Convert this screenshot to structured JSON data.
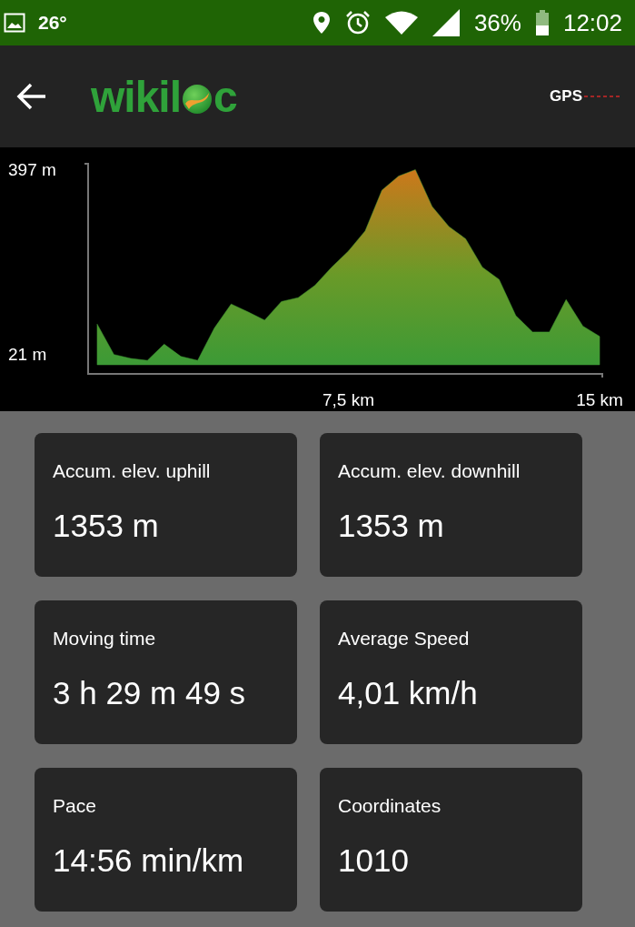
{
  "status_bar": {
    "temperature": "26°",
    "battery": "36%",
    "time": "12:02"
  },
  "header": {
    "logo": [
      "wikil",
      "c"
    ],
    "gps": "GPS"
  },
  "elevation": {
    "chart_data": {
      "type": "area",
      "x": [
        0,
        0.5,
        1,
        1.5,
        2,
        2.5,
        3,
        3.5,
        4,
        4.5,
        5,
        5.5,
        6,
        6.5,
        7,
        7.5,
        8,
        8.5,
        9,
        9.5,
        10,
        10.5,
        11,
        11.5,
        12,
        12.5,
        13,
        13.5,
        14,
        14.5,
        15
      ],
      "series": [
        {
          "color": "#3f9a35",
          "values": [
            83,
            21,
            13,
            9,
            42,
            17,
            9,
            75,
            124,
            108,
            91,
            129,
            137,
            162,
            199,
            232,
            273,
            356,
            385,
            398,
            323,
            282,
            257,
            199,
            174,
            100,
            67,
            67,
            133,
            79,
            58
          ]
        }
      ],
      "xlim": [
        -0.27,
        15.08
      ],
      "ylim": [
        0,
        410
      ],
      "xticks": [
        {
          "value": 7.5,
          "label": "7,5 km"
        },
        {
          "value": 15,
          "label": "15 km"
        }
      ],
      "yticks": [
        {
          "value": 21,
          "label": "21 m"
        },
        {
          "value": 397,
          "label": "397 m"
        }
      ]
    }
  },
  "stats": [
    {
      "label": "Accum. elev. uphill",
      "value": "1353 m"
    },
    {
      "label": "Accum. elev. downhill",
      "value": "1353 m"
    },
    {
      "label": "Moving time",
      "value": "3 h 29 m 49 s"
    },
    {
      "label": "Average Speed",
      "value": "4,01 km/h"
    },
    {
      "label": "Pace",
      "value": "14:56 min/km"
    },
    {
      "label": "Coordinates",
      "value": "1010"
    }
  ]
}
